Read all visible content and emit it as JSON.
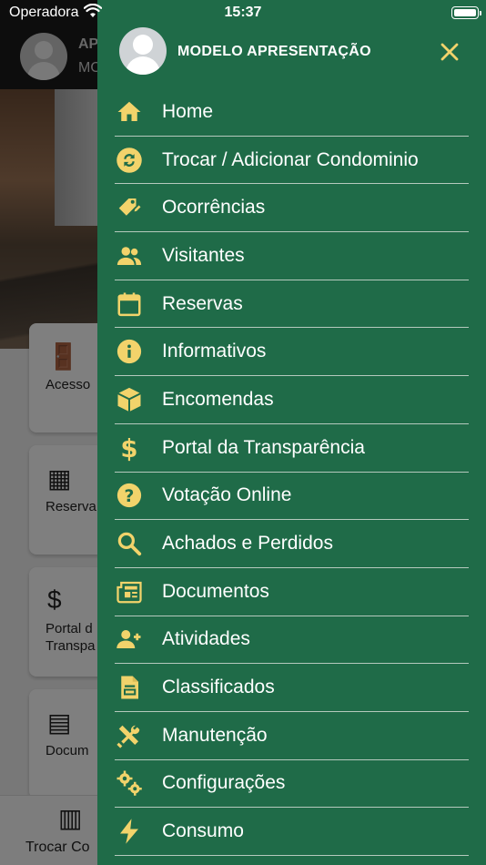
{
  "status_bar": {
    "carrier": "Operadora",
    "time": "15:37"
  },
  "background": {
    "header_title": "AP",
    "header_subtitle": "MO",
    "cards": [
      {
        "label": "Acesso"
      },
      {
        "label": "Reserva"
      },
      {
        "label": "Portal d\nTranspa"
      },
      {
        "label": "Docum"
      }
    ],
    "tab_label": "Trocar Co"
  },
  "drawer": {
    "user_name": "MODELO APRESENTAÇÃO",
    "accent_color": "#f2d36b",
    "background_color": "#1f6b48",
    "items": [
      {
        "label": "Home",
        "icon": "home-icon"
      },
      {
        "label": "Trocar / Adicionar Condominio",
        "icon": "swap-icon"
      },
      {
        "label": "Ocorrências",
        "icon": "tag-edit-icon"
      },
      {
        "label": "Visitantes",
        "icon": "people-icon"
      },
      {
        "label": "Reservas",
        "icon": "calendar-icon"
      },
      {
        "label": "Informativos",
        "icon": "info-icon"
      },
      {
        "label": "Encomendas",
        "icon": "package-icon"
      },
      {
        "label": "Portal da Transparência",
        "icon": "dollar-icon"
      },
      {
        "label": "Votação Online",
        "icon": "help-icon"
      },
      {
        "label": "Achados e Perdidos",
        "icon": "search-icon"
      },
      {
        "label": "Documentos",
        "icon": "newspaper-icon"
      },
      {
        "label": "Atividades",
        "icon": "person-add-icon"
      },
      {
        "label": "Classificados",
        "icon": "document-icon"
      },
      {
        "label": "Manutenção",
        "icon": "tools-icon"
      },
      {
        "label": "Configurações",
        "icon": "gears-icon"
      },
      {
        "label": "Consumo",
        "icon": "lightning-icon"
      }
    ]
  }
}
